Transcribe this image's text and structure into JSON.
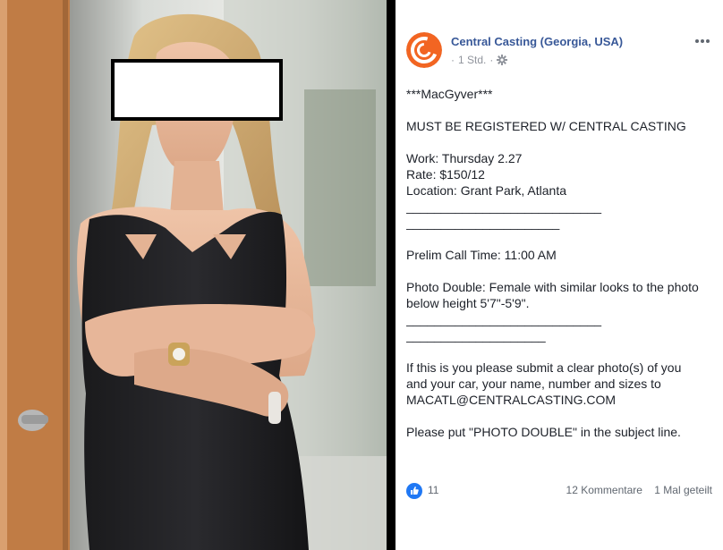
{
  "post": {
    "page_name": "Central Casting (Georgia, USA)",
    "timestamp": "1 Std.",
    "meta_separator": "·",
    "body": {
      "title": "***MacGyver***",
      "requirement": "MUST BE REGISTERED W/ CENTRAL CASTING",
      "work": "Work: Thursday 2.27",
      "rate": "Rate: $150/12",
      "location": "Location: Grant Park, Atlanta",
      "rule_a1": "____________________________",
      "rule_a2": "______________________",
      "call_time": "Prelim Call Time: 11:00 AM",
      "role_line1": "Photo Double: Female with similar looks to the photo",
      "role_line2": "below height 5'7\"-5'9\".",
      "rule_b1": "____________________________",
      "rule_b2": "____________________",
      "submit_line1": "If this is you please submit a clear photo(s) of you",
      "submit_line2": "and your car, your name, number and sizes to",
      "submit_line3": "MACATL@CENTRALCASTING.COM",
      "subject_line": "Please put \"PHOTO DOUBLE\" in the subject line."
    },
    "footer": {
      "like_count": "11",
      "comments": "12 Kommentare",
      "shares": "1 Mal geteilt"
    }
  },
  "colors": {
    "link_blue": "#385898",
    "brand_orange": "#f26522",
    "like_blue": "#2078f4",
    "meta_gray": "#90949c",
    "text": "#1d2129"
  },
  "icons": {
    "avatar": "central-casting-logo",
    "privacy": "gear-icon",
    "more": "more-options-icon",
    "like": "thumbs-up-icon"
  }
}
